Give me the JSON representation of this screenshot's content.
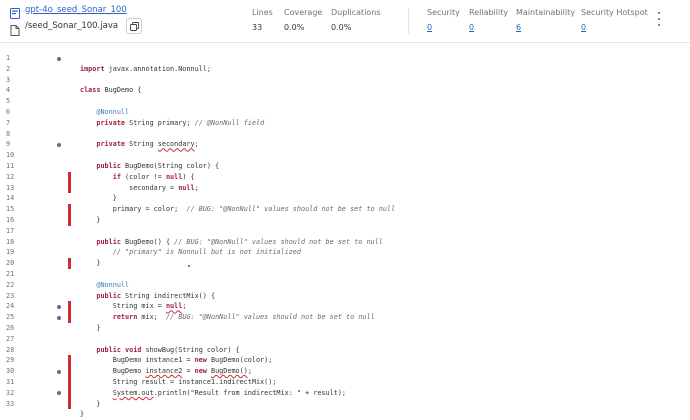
{
  "header": {
    "project_name": "gpt-4o_seed_Sonar_100",
    "file_path": "/seed_Sonar_100.java",
    "metrics": [
      {
        "label": "Lines",
        "value": "33",
        "link": false
      },
      {
        "label": "Coverage",
        "value": "0.0%",
        "link": false
      },
      {
        "label": "Duplications",
        "value": "0.0%",
        "link": false
      },
      {
        "label": "Security",
        "value": "0",
        "link": true
      },
      {
        "label": "Reliability",
        "value": "0",
        "link": true
      },
      {
        "label": "Maintainability",
        "value": "6",
        "link": true
      },
      {
        "label": "Security Hotspot",
        "value": "0",
        "link": true
      }
    ],
    "icons": {
      "project": "project-icon",
      "file": "file-icon",
      "copy": "copy-icon",
      "menu": "kebab-menu-icon"
    }
  },
  "colors": {
    "link": "#2d63c7",
    "issue_bar": "#d02b37",
    "keyword": "#9d1f44",
    "annotation": "#3e7cb5",
    "comment": "#6b6b6b"
  },
  "code": {
    "lines": [
      {
        "n": "1",
        "dot": true,
        "bar": false,
        "segs": [
          {
            "t": ""
          }
        ]
      },
      {
        "n": "2",
        "dot": false,
        "bar": false,
        "segs": [
          {
            "t": "import",
            "c": "kw"
          },
          {
            "t": " javax.annotation.Nonnull;"
          }
        ]
      },
      {
        "n": "3",
        "dot": false,
        "bar": false,
        "segs": [
          {
            "t": ""
          }
        ]
      },
      {
        "n": "4",
        "dot": false,
        "bar": false,
        "segs": [
          {
            "t": "class",
            "c": "kw"
          },
          {
            "t": " BugDemo {"
          }
        ]
      },
      {
        "n": "5",
        "dot": false,
        "bar": false,
        "segs": [
          {
            "t": ""
          }
        ]
      },
      {
        "n": "6",
        "dot": false,
        "bar": false,
        "segs": [
          {
            "t": "    "
          },
          {
            "t": "@Nonnull",
            "c": "an"
          }
        ]
      },
      {
        "n": "7",
        "dot": false,
        "bar": false,
        "segs": [
          {
            "t": "    "
          },
          {
            "t": "private",
            "c": "kw"
          },
          {
            "t": " String primary; "
          },
          {
            "t": "// @NonNull field",
            "c": "cm"
          }
        ]
      },
      {
        "n": "8",
        "dot": false,
        "bar": false,
        "segs": [
          {
            "t": ""
          }
        ]
      },
      {
        "n": "9",
        "dot": true,
        "bar": false,
        "segs": [
          {
            "t": "    "
          },
          {
            "t": "private",
            "c": "kw"
          },
          {
            "t": " String "
          },
          {
            "t": "secondary",
            "c": "sq"
          },
          {
            "t": ";"
          }
        ]
      },
      {
        "n": "10",
        "dot": false,
        "bar": false,
        "segs": [
          {
            "t": ""
          }
        ]
      },
      {
        "n": "11",
        "dot": false,
        "bar": false,
        "segs": [
          {
            "t": "    "
          },
          {
            "t": "public",
            "c": "kw"
          },
          {
            "t": " BugDemo(String color) {"
          }
        ]
      },
      {
        "n": "12",
        "dot": false,
        "bar": true,
        "segs": [
          {
            "t": "        "
          },
          {
            "t": "if",
            "c": "kw"
          },
          {
            "t": " (color != "
          },
          {
            "t": "null",
            "c": "kw"
          },
          {
            "t": ") {"
          }
        ]
      },
      {
        "n": "13",
        "dot": false,
        "bar": true,
        "segs": [
          {
            "t": "            secondary = "
          },
          {
            "t": "null",
            "c": "kw"
          },
          {
            "t": ";"
          }
        ]
      },
      {
        "n": "14",
        "dot": false,
        "bar": false,
        "segs": [
          {
            "t": "        }"
          }
        ]
      },
      {
        "n": "15",
        "dot": false,
        "bar": true,
        "segs": [
          {
            "t": "        primary = color;  "
          },
          {
            "t": "// BUG: \"@NonNull\" values should not be set to null",
            "c": "cm"
          }
        ]
      },
      {
        "n": "16",
        "dot": false,
        "bar": true,
        "segs": [
          {
            "t": "    }"
          }
        ]
      },
      {
        "n": "17",
        "dot": false,
        "bar": false,
        "segs": [
          {
            "t": ""
          }
        ]
      },
      {
        "n": "18",
        "dot": false,
        "bar": false,
        "segs": [
          {
            "t": "    "
          },
          {
            "t": "public",
            "c": "kw"
          },
          {
            "t": " BugDemo() { "
          },
          {
            "t": "// BUG: \"@NonNull\" values should not be set to null",
            "c": "cm"
          }
        ]
      },
      {
        "n": "19",
        "dot": false,
        "bar": false,
        "segs": [
          {
            "t": "        "
          },
          {
            "t": "// \"primary\" is Nonnull but is not initialized",
            "c": "cm"
          }
        ]
      },
      {
        "n": "20",
        "dot": false,
        "bar": true,
        "segs": [
          {
            "t": "    }"
          }
        ]
      },
      {
        "n": "21",
        "dot": false,
        "bar": false,
        "segs": [
          {
            "t": ""
          }
        ]
      },
      {
        "n": "22",
        "dot": false,
        "bar": false,
        "segs": [
          {
            "t": "    "
          },
          {
            "t": "@Nonnull",
            "c": "an"
          }
        ]
      },
      {
        "n": "23",
        "dot": false,
        "bar": false,
        "segs": [
          {
            "t": "    "
          },
          {
            "t": "public",
            "c": "kw"
          },
          {
            "t": " String indirectMix() {"
          }
        ]
      },
      {
        "n": "24",
        "dot": true,
        "bar": true,
        "segs": [
          {
            "t": "        String mix = "
          },
          {
            "t": "null",
            "c": "kw sq"
          },
          {
            "t": ";"
          }
        ]
      },
      {
        "n": "25",
        "dot": true,
        "bar": true,
        "segs": [
          {
            "t": "        "
          },
          {
            "t": "return",
            "c": "kw"
          },
          {
            "t": " mix;  "
          },
          {
            "t": "// BUG: \"@NonNull\" values should not be set to null",
            "c": "cm"
          }
        ]
      },
      {
        "n": "26",
        "dot": false,
        "bar": false,
        "segs": [
          {
            "t": "    }"
          }
        ]
      },
      {
        "n": "27",
        "dot": false,
        "bar": false,
        "segs": [
          {
            "t": ""
          }
        ]
      },
      {
        "n": "28",
        "dot": false,
        "bar": false,
        "segs": [
          {
            "t": "    "
          },
          {
            "t": "public",
            "c": "kw"
          },
          {
            "t": " "
          },
          {
            "t": "void",
            "c": "kw"
          },
          {
            "t": " showBug(String color) {"
          }
        ]
      },
      {
        "n": "29",
        "dot": false,
        "bar": true,
        "segs": [
          {
            "t": "        BugDemo instance1 = "
          },
          {
            "t": "new",
            "c": "kw"
          },
          {
            "t": " BugDemo(color);"
          }
        ]
      },
      {
        "n": "30",
        "dot": true,
        "bar": true,
        "segs": [
          {
            "t": "        BugDemo "
          },
          {
            "t": "instance2",
            "c": "sq"
          },
          {
            "t": " = "
          },
          {
            "t": "new",
            "c": "kw"
          },
          {
            "t": " "
          },
          {
            "t": "BugDemo()",
            "c": "sq"
          },
          {
            "t": ";"
          }
        ]
      },
      {
        "n": "31",
        "dot": false,
        "bar": true,
        "segs": [
          {
            "t": "        String result = instance1.indirectMix();"
          }
        ]
      },
      {
        "n": "32",
        "dot": true,
        "bar": true,
        "segs": [
          {
            "t": "        "
          },
          {
            "t": "System.out",
            "c": "sq"
          },
          {
            "t": ".println(\"Result from indirectMix: \" + result);"
          }
        ]
      },
      {
        "n": "33",
        "dot": false,
        "bar": true,
        "segs": [
          {
            "t": "    }"
          }
        ]
      },
      {
        "n": "",
        "dot": false,
        "bar": false,
        "segs": [
          {
            "t": "}"
          }
        ]
      }
    ]
  }
}
